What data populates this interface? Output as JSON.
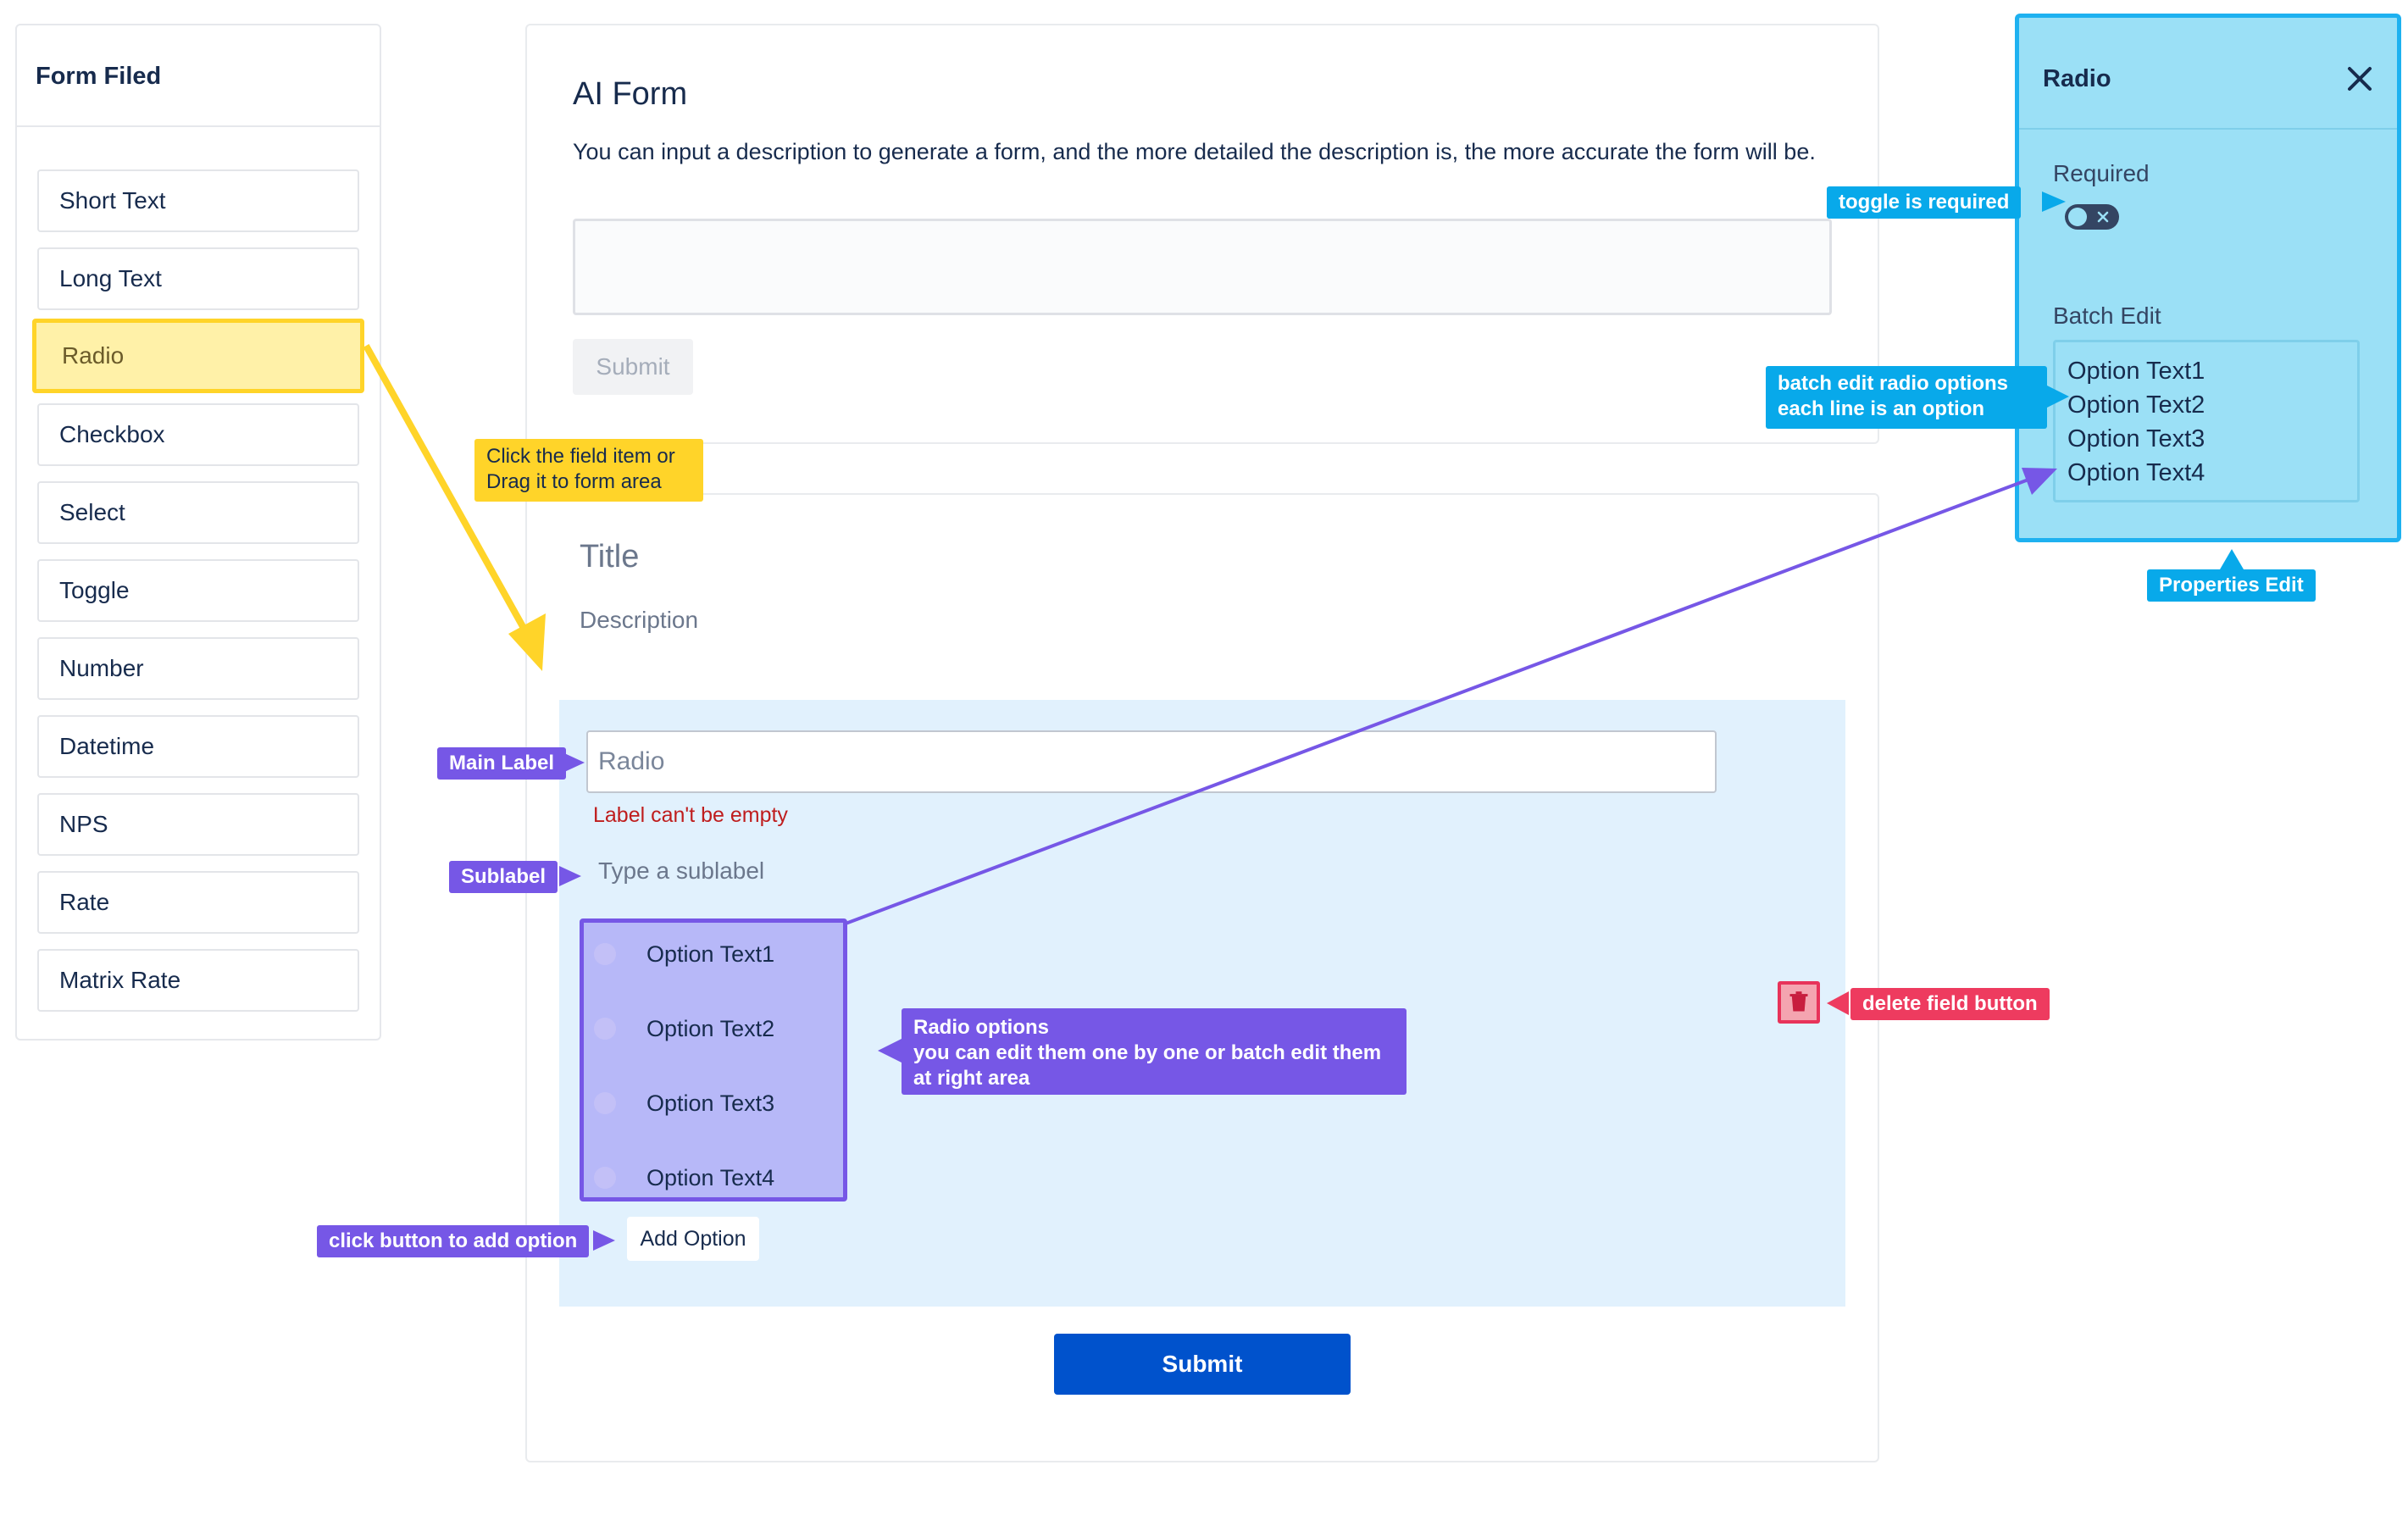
{
  "sidebar": {
    "title": "Form Filed",
    "items": [
      {
        "label": "Short Text"
      },
      {
        "label": "Long Text"
      },
      {
        "label": "Radio",
        "highlighted": true
      },
      {
        "label": "Checkbox"
      },
      {
        "label": "Select"
      },
      {
        "label": "Toggle"
      },
      {
        "label": "Number"
      },
      {
        "label": "Datetime"
      },
      {
        "label": "NPS"
      },
      {
        "label": "Rate"
      },
      {
        "label": "Matrix Rate"
      }
    ]
  },
  "ai_form": {
    "title": "AI Form",
    "description": "You can input a description to generate a form, and the more detailed the description is, the more accurate the form will be.",
    "input_value": "",
    "submit_label": "Submit"
  },
  "form": {
    "title_placeholder": "Title",
    "description_placeholder": "Description",
    "field": {
      "label_value": "Radio",
      "label_error": "Label can't be empty",
      "sublabel_placeholder": "Type a sublabel",
      "options": [
        "Option Text1",
        "Option Text2",
        "Option Text3",
        "Option Text4"
      ],
      "add_option_label": "Add Option"
    },
    "submit_label": "Submit"
  },
  "properties": {
    "title": "Radio",
    "required_label": "Required",
    "required_on": false,
    "batch_edit_label": "Batch Edit",
    "batch_edit_lines": [
      "Option Text1",
      "Option Text2",
      "Option Text3",
      "Option Text4"
    ]
  },
  "annotations": {
    "drag_hint_line1": "Click the field item or",
    "drag_hint_line2": "Drag it to form area",
    "main_label": "Main Label",
    "sublabel": "Sublabel",
    "radio_options_line1": "Radio options",
    "radio_options_line2": "you can edit them one by one or batch edit them",
    "radio_options_line3": "at right area",
    "add_option": "click button to add option",
    "delete_field": "delete field button",
    "toggle_required": "toggle is required",
    "batch_edit_line1": "batch edit radio options",
    "batch_edit_line2": "each line is an option",
    "properties_edit": "Properties Edit"
  },
  "icons": {
    "close": "close-icon",
    "delete": "trash-icon",
    "toggle_off": "x-icon"
  },
  "colors": {
    "highlight_yellow": "#ffd429",
    "annotation_purple": "#7657e6",
    "annotation_blue": "#08a9ea",
    "annotation_red": "#ee3b5f",
    "primary_button": "#0052cc",
    "error_text": "#bf1d1d"
  }
}
